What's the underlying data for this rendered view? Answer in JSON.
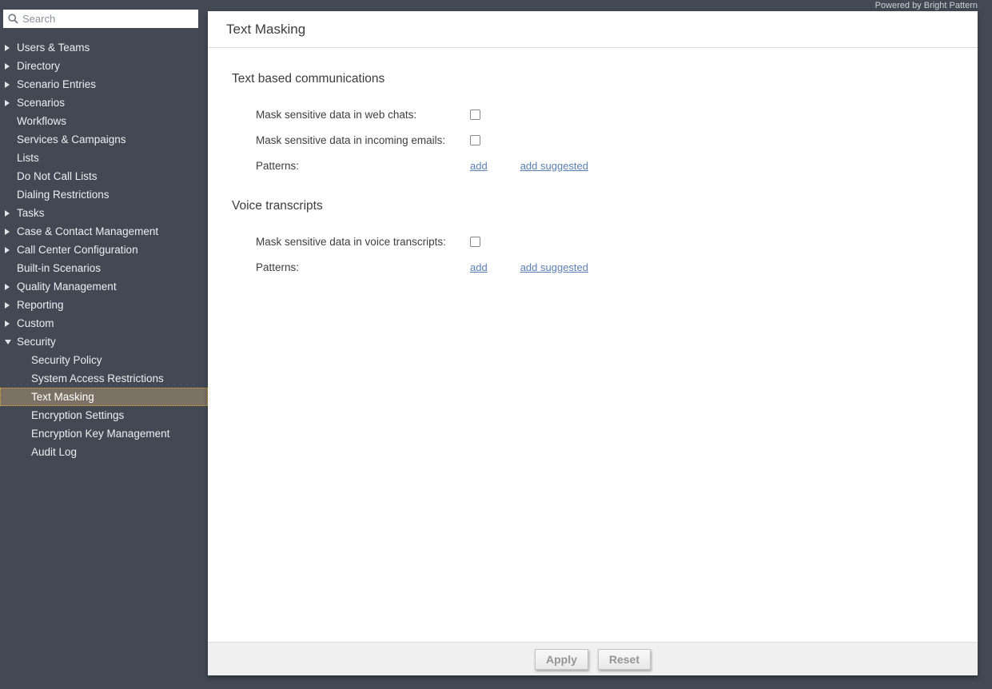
{
  "top_bar": {
    "powered_by": "Powered by Bright Pattern"
  },
  "sidebar": {
    "search_placeholder": "Search",
    "items": [
      {
        "label": "Users & Teams",
        "arrow": "right",
        "level": 0
      },
      {
        "label": "Directory",
        "arrow": "right",
        "level": 0
      },
      {
        "label": "Scenario Entries",
        "arrow": "right",
        "level": 0
      },
      {
        "label": "Scenarios",
        "arrow": "right",
        "level": 0
      },
      {
        "label": "Workflows",
        "arrow": "none",
        "level": 0
      },
      {
        "label": "Services & Campaigns",
        "arrow": "none",
        "level": 0
      },
      {
        "label": "Lists",
        "arrow": "none",
        "level": 0
      },
      {
        "label": "Do Not Call Lists",
        "arrow": "none",
        "level": 0
      },
      {
        "label": "Dialing Restrictions",
        "arrow": "none",
        "level": 0
      },
      {
        "label": "Tasks",
        "arrow": "right",
        "level": 0
      },
      {
        "label": "Case & Contact Management",
        "arrow": "right",
        "level": 0
      },
      {
        "label": "Call Center Configuration",
        "arrow": "right",
        "level": 0
      },
      {
        "label": "Built-in Scenarios",
        "arrow": "none",
        "level": 0
      },
      {
        "label": "Quality Management",
        "arrow": "right",
        "level": 0
      },
      {
        "label": "Reporting",
        "arrow": "right",
        "level": 0
      },
      {
        "label": "Custom",
        "arrow": "right",
        "level": 0
      },
      {
        "label": "Security",
        "arrow": "down",
        "level": 0,
        "expanded": true
      },
      {
        "label": "Security Policy",
        "arrow": "none",
        "level": 1
      },
      {
        "label": "System Access Restrictions",
        "arrow": "none",
        "level": 1
      },
      {
        "label": "Text Masking",
        "arrow": "none",
        "level": 1,
        "selected": true
      },
      {
        "label": "Encryption Settings",
        "arrow": "none",
        "level": 1
      },
      {
        "label": "Encryption Key Management",
        "arrow": "none",
        "level": 1
      },
      {
        "label": "Audit Log",
        "arrow": "none",
        "level": 1
      }
    ]
  },
  "main": {
    "title": "Text Masking",
    "sections": [
      {
        "heading": "Text based communications",
        "rows": [
          {
            "label": "Mask sensitive data in web chats:",
            "control": "checkbox",
            "checked": false
          },
          {
            "label": "Mask sensitive data in incoming emails:",
            "control": "checkbox",
            "checked": false
          },
          {
            "label": "Patterns:",
            "control": "links",
            "links": [
              "add",
              "add suggested"
            ]
          }
        ]
      },
      {
        "heading": "Voice transcripts",
        "rows": [
          {
            "label": "Mask sensitive data in voice transcripts:",
            "control": "checkbox",
            "checked": false
          },
          {
            "label": "Patterns:",
            "control": "links",
            "links": [
              "add",
              "add suggested"
            ]
          }
        ]
      }
    ]
  },
  "footer": {
    "apply_label": "Apply",
    "reset_label": "Reset"
  },
  "colors": {
    "background_dark": "#424954",
    "selected_item_bg": "#7b7265",
    "selected_item_border": "#e3a82f",
    "link": "#5a7fb5",
    "panel_bg": "#ffffff",
    "footer_bg": "#f0f0f0"
  }
}
